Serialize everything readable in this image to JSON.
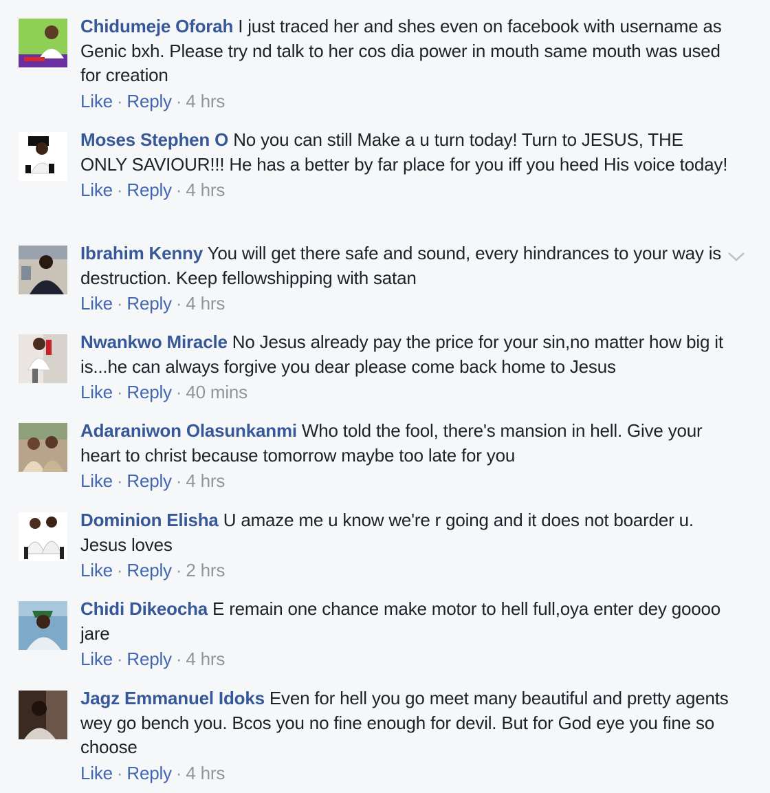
{
  "comments": [
    {
      "author": "Chidumeje Oforah",
      "text": "I just traced her and shes even on facebook with username as Genic bxh. Please try nd talk to her cos dia power in mouth same mouth was used for creation",
      "like": "Like",
      "reply": "Reply",
      "time": "4 hrs"
    },
    {
      "author": "Moses Stephen O",
      "text": "No you can still Make a u turn today! Turn to JESUS, THE ONLY SAVIOUR!!! He has a better by far place for you iff you heed His voice today!",
      "like": "Like",
      "reply": "Reply",
      "time": "4 hrs"
    },
    {
      "author": "Ibrahim Kenny",
      "text": "You will get there safe and sound, every hindrances to your way is destruction. Keep fellowshipping with satan",
      "like": "Like",
      "reply": "Reply",
      "time": "4 hrs"
    },
    {
      "author": "Nwankwo Miracle",
      "text": "No Jesus already pay the price for your sin,no matter how big it is...he can always forgive you dear please come back home to Jesus",
      "like": "Like",
      "reply": "Reply",
      "time": "40 mins"
    },
    {
      "author": "Adaraniwon Olasunkanmi",
      "text": "Who told the fool, there's mansion in hell. Give your heart to christ because tomorrow maybe too late for you",
      "like": "Like",
      "reply": "Reply",
      "time": "4 hrs"
    },
    {
      "author": "Dominion Elisha",
      "text": "U amaze me u know we're r going and it does not boarder u. Jesus loves",
      "like": "Like",
      "reply": "Reply",
      "time": "2 hrs"
    },
    {
      "author": "Chidi Dikeocha",
      "text": "E remain one chance make motor to hell full,oya enter dey goooo jare",
      "like": "Like",
      "reply": "Reply",
      "time": "4 hrs"
    },
    {
      "author": "Jagz Emmanuel Idoks",
      "text": "Even for hell you go meet many beautiful and pretty agents wey go bench you. Bcos you no fine enough for devil. But for God eye you fine so choose",
      "like": "Like",
      "reply": "Reply",
      "time": "4 hrs"
    }
  ],
  "colors": {
    "author": "#365899",
    "action": "#4267b2",
    "meta": "#90949c",
    "text": "#1d2129"
  },
  "icons": {
    "menu": "chevron-down-icon"
  }
}
